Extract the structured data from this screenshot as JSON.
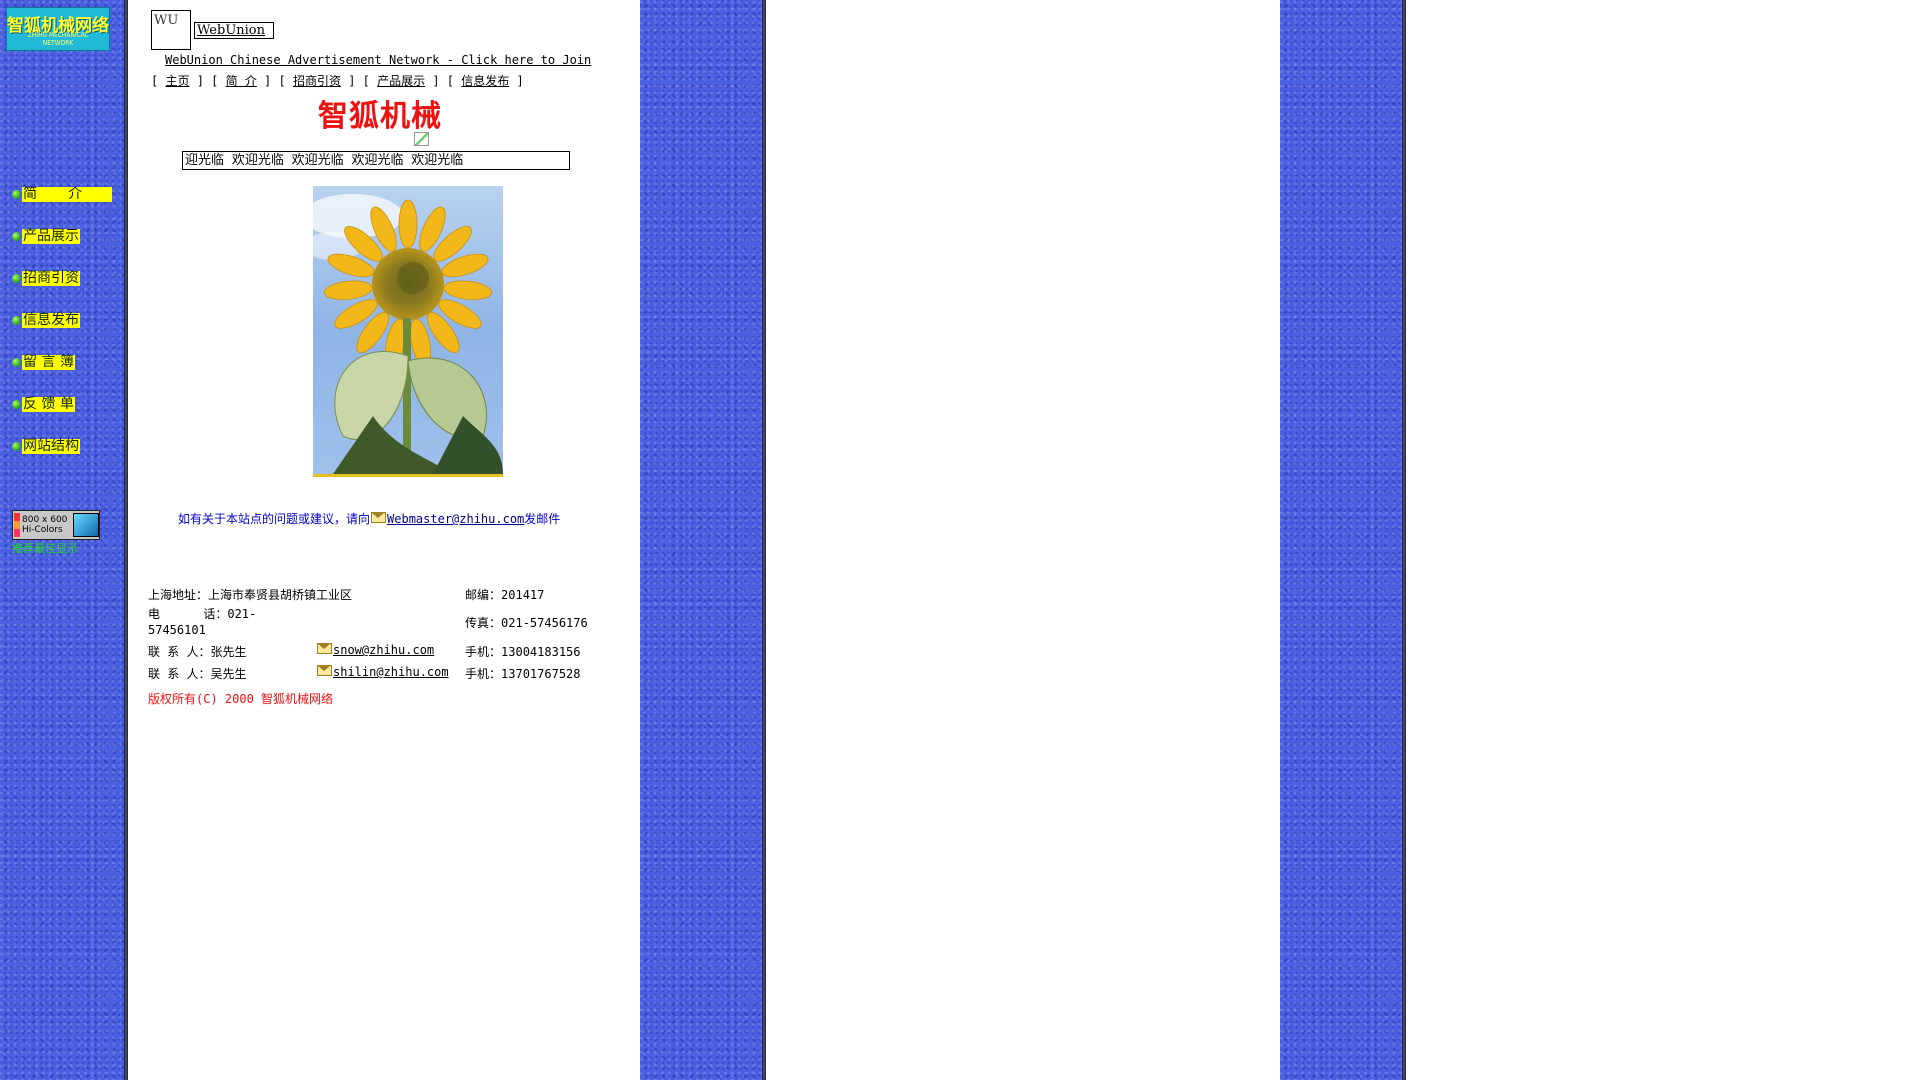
{
  "logo": {
    "title_cn": "智狐机械网络",
    "title_en": "ZHIHU MECHANICAL NETWORK"
  },
  "sidebar": {
    "items": [
      {
        "label": "简       介"
      },
      {
        "label": "产品展示"
      },
      {
        "label": "招商引资"
      },
      {
        "label": "信息发布"
      },
      {
        "label": "留 言 簿"
      },
      {
        "label": "反 馈 单"
      },
      {
        "label": "网站结构"
      }
    ],
    "resolution_badge": "800 x 600\nHi-Colors",
    "resolution_note": "推荐最佳显示"
  },
  "header": {
    "wu_alt": "WU",
    "webunion_alt": "WebUnion",
    "join_text": "WebUnion Chinese Advertisement Network - Click here to Join",
    "nav": [
      {
        "label": "主页"
      },
      {
        "label": "简 介"
      },
      {
        "label": "招商引资"
      },
      {
        "label": "产品展示"
      },
      {
        "label": "信息发布"
      }
    ],
    "site_title": "智狐机械",
    "marquee_text": "迎光临    欢迎光临    欢迎光临    欢迎光临    欢迎光临"
  },
  "contact": {
    "prefix": "如有关于本站点的问题或建议，请向",
    "email": "Webmaster@zhihu.com",
    "suffix": "发邮件"
  },
  "info": {
    "address_label": "上海地址：",
    "address": "上海市奉贤县胡桥镇工业区",
    "postcode_label": "邮编：",
    "postcode": "201417",
    "phone_label": "电      话：",
    "phone": "021-57456101",
    "fax_label": "传真：",
    "fax": "021-57456176",
    "contacts": [
      {
        "label": "联 系 人：",
        "name": "张先生",
        "email": "snow@zhihu.com",
        "mobile_label": "手机：",
        "mobile": "13004183156"
      },
      {
        "label": "联 系 人：",
        "name": "吴先生",
        "email": "shilin@zhihu.com",
        "mobile_label": "手机：",
        "mobile": "13701767528"
      }
    ],
    "copyright": "版权所有(C) 2000 智狐机械网络"
  },
  "colors": {
    "stripe_blue": "#4a5ee0",
    "nav_yellow": "#ffff00",
    "title_red": "#ee1111",
    "contact_blue": "#0000cc"
  }
}
